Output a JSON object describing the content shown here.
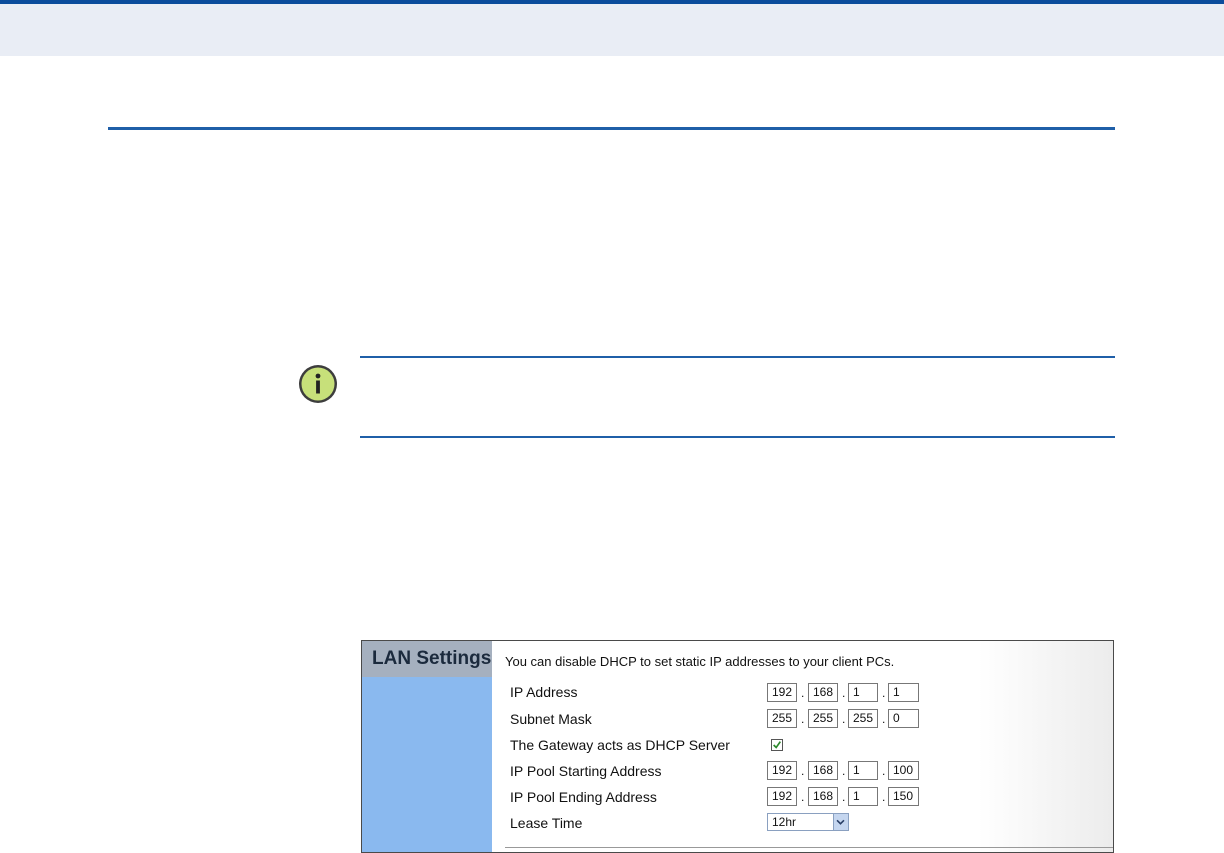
{
  "note": {
    "icon": "info-icon"
  },
  "lan": {
    "title": "LAN Settings",
    "description": "You can disable DHCP to set static IP addresses to your client PCs.",
    "rows": {
      "ip_address": {
        "label": "IP Address",
        "octets": [
          "192",
          "168",
          "1",
          "1"
        ]
      },
      "subnet_mask": {
        "label": "Subnet Mask",
        "octets": [
          "255",
          "255",
          "255",
          "0"
        ]
      },
      "dhcp_server": {
        "label": "The Gateway acts as DHCP Server",
        "checked": true
      },
      "pool_start": {
        "label": "IP Pool Starting Address",
        "octets": [
          "192",
          "168",
          "1",
          "100"
        ]
      },
      "pool_end": {
        "label": "IP Pool Ending Address",
        "octets": [
          "192",
          "168",
          "1",
          "150"
        ]
      },
      "lease_time": {
        "label": "Lease Time",
        "value": "12hr"
      }
    }
  },
  "colors": {
    "brand_blue": "#1f5fa8",
    "sidebar_blue": "#8ab9ef",
    "title_gray": "#a5b0bf",
    "icon_green": "#c7e07a"
  }
}
